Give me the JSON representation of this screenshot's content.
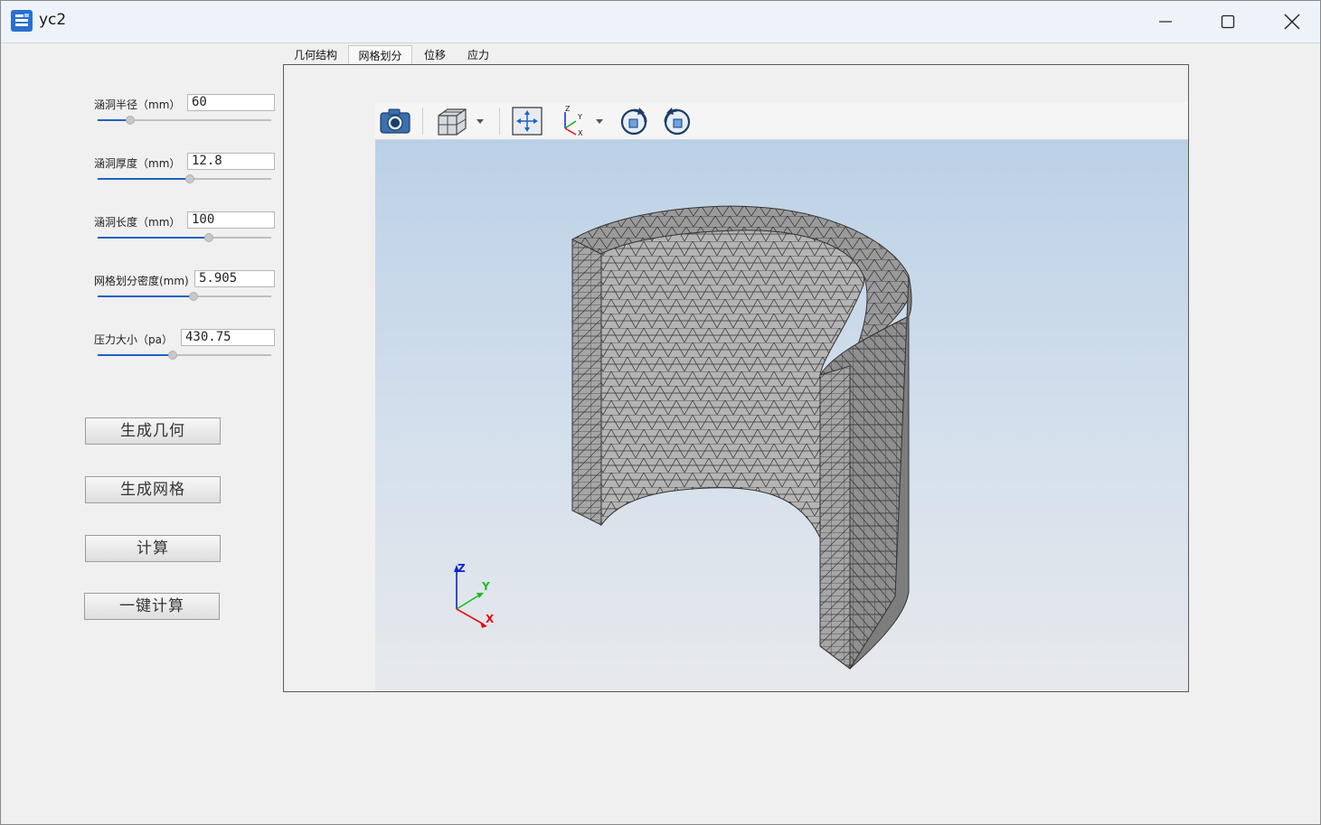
{
  "window": {
    "title": "yc2",
    "controls": [
      "minimize",
      "maximize",
      "close"
    ]
  },
  "params": [
    {
      "label": "涵洞半径（mm）",
      "value": "60",
      "slider_fraction": 0.19
    },
    {
      "label": "涵洞厚度（mm）",
      "value": "12.8",
      "slider_fraction": 0.53
    },
    {
      "label": "涵洞长度（mm）",
      "value": "100",
      "slider_fraction": 0.64
    },
    {
      "label": "网格划分密度(mm)",
      "value": "5.905",
      "slider_fraction": 0.55
    },
    {
      "label": "压力大小（pa）",
      "value": "430.75",
      "slider_fraction": 0.43
    }
  ],
  "buttons": {
    "gen_geometry": "生成几何",
    "gen_mesh": "生成网格",
    "compute": "计算",
    "one_click": "一键计算"
  },
  "tabs": [
    {
      "label": "几何结构",
      "active": false
    },
    {
      "label": "网格划分",
      "active": true
    },
    {
      "label": "位移",
      "active": false
    },
    {
      "label": "应力",
      "active": false
    }
  ],
  "viewer_toolbar": [
    {
      "icon": "camera-icon"
    },
    {
      "icon": "view-cube-icon"
    },
    {
      "icon": "fit-view-icon"
    },
    {
      "icon": "axes-icon"
    },
    {
      "icon": "rotate-cw-icon"
    },
    {
      "icon": "rotate-ccw-icon"
    }
  ],
  "triad": {
    "x": "X",
    "y": "Y",
    "z": "Z"
  },
  "colors": {
    "accent": "#1e63c4",
    "mesh_fill": "#a9a9a9",
    "mesh_line": "#3a3a3a",
    "axis_x": "#e01010",
    "axis_y": "#22bb22",
    "axis_z": "#1020d0"
  }
}
